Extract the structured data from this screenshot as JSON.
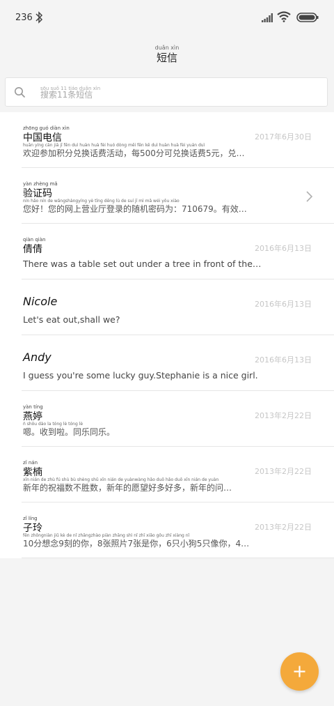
{
  "status_bar": {
    "time": "236",
    "icons": [
      "bluetooth-icon",
      "signal-icon",
      "wifi-icon",
      "battery-icon"
    ]
  },
  "header": {
    "title_ruby": "duǎn xìn",
    "title": "短信"
  },
  "search": {
    "ruby": "sōu suǒ  11  tiáo duǎn xìn",
    "placeholder": "搜索11条短信"
  },
  "messages": [
    {
      "name_ruby": "zhōng guó diàn xìn",
      "name": "中国电信",
      "date": "2017年6月30日",
      "preview_ruby": "huān yíng cān jiā jī fēn duì huàn huà fèi huó dòng   měi   fēn kě duì huàn huà fèi   yuán   duì",
      "preview": "欢迎参加积分兑换话费活动，每500分可兑换话费5元，兑…"
    },
    {
      "name_ruby": "yàn zhèng mǎ",
      "name": "验证码",
      "date": "",
      "preview_ruby": "nín hǎo   nín de wǎngshàngyíng yè tīng dēng lù de suí jī mì mǎ wéi   yǒu xiào",
      "preview": "您好！您的网上营业厅登录的随机密码为：710679。有效…"
    },
    {
      "name_ruby": "qiàn qiàn",
      "name": "倩倩",
      "date": "2016年6月13日",
      "preview_ruby": "",
      "preview": "There was a table set out under a tree in front of the…"
    },
    {
      "name_ruby": "",
      "name": "Nicole",
      "date": "2016年6月13日",
      "preview_ruby": "",
      "preview": "Let's eat out,shall we?"
    },
    {
      "name_ruby": "",
      "name": "Andy",
      "date": "2016年6月13日",
      "preview_ruby": "",
      "preview": "I guess you're some lucky guy.Stephanie is a nice girl."
    },
    {
      "name_ruby": "yàn tíng",
      "name": "燕婷",
      "date": "2013年2月22日",
      "preview_ruby": "ǹ   shōu dào la   tóng lè tóng lè",
      "preview": "嗯。收到啦。同乐同乐。"
    },
    {
      "name_ruby": "zǐ nán",
      "name": "紫楠",
      "date": "2013年2月22日",
      "preview_ruby": "xīn nián de zhù fú shù bù shèng shǔ   xīn nián de yuànwàng hǎo duō hǎo duō   xīn nián de yuàn",
      "preview": "新年的祝福数不胜数，新年的愿望好多好多，新年的问…"
    },
    {
      "name_ruby": "zǐ líng",
      "name": "子玲",
      "date": "2013年2月22日",
      "preview_ruby": "fēn zhōngniàn jiǔ kè de nǐ   zhāngzhào piàn   zhāng shì nǐ   zhī xiǎo gǒu   zhī xiàng nǐ",
      "preview": "10分想念9刻的你，8张照片7张是你，6只小狗5只像你，4…"
    }
  ],
  "fab": {
    "icon": "plus-icon",
    "color": "#f4a93b"
  }
}
